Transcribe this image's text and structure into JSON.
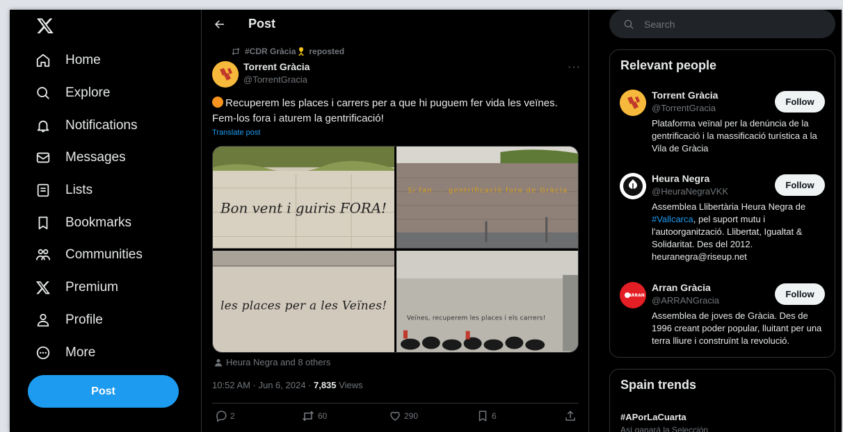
{
  "nav": {
    "items": [
      {
        "label": "Home",
        "icon": "home-icon"
      },
      {
        "label": "Explore",
        "icon": "search-icon"
      },
      {
        "label": "Notifications",
        "icon": "bell-icon"
      },
      {
        "label": "Messages",
        "icon": "envelope-icon"
      },
      {
        "label": "Lists",
        "icon": "list-icon"
      },
      {
        "label": "Bookmarks",
        "icon": "bookmark-icon"
      },
      {
        "label": "Communities",
        "icon": "people-icon"
      },
      {
        "label": "Premium",
        "icon": "x-logo-icon"
      },
      {
        "label": "Profile",
        "icon": "person-icon"
      },
      {
        "label": "More",
        "icon": "more-circle-icon"
      }
    ],
    "post_label": "Post"
  },
  "main": {
    "title": "Post",
    "repost": {
      "reposter": "#CDR Gràcia",
      "suffix": "reposted"
    },
    "tweet": {
      "author_name": "Torrent Gràcia",
      "author_handle": "@TorrentGracia",
      "text": "Recuperem les places i carrers per a que hi puguem fer vida les veïnes. Fem-los fora i aturem la gentrificació!",
      "translate_label": "Translate post",
      "liked_by": "Heura Negra and 8 others",
      "time": "10:52 AM · Jun 6, 2024 · ",
      "views_count": "7,835",
      "views_label": " Views",
      "images": [
        {
          "caption": "Bon vent i guiris FORA!"
        },
        {
          "caption": "Si fan ... gentrificació fora de Gràcia"
        },
        {
          "caption": "les places per a les Veïnes!"
        },
        {
          "caption": "Veïnes, recuperem les places i els carrers!"
        }
      ],
      "actions": {
        "replies": "2",
        "reposts": "60",
        "likes": "290",
        "bookmarks": "6"
      }
    }
  },
  "right": {
    "search_placeholder": "Search",
    "relevant_title": "Relevant people",
    "people": [
      {
        "name": "Torrent Gràcia",
        "handle": "@TorrentGracia",
        "bio": "Plataforma veïnal per la denúncia de la gentrificació i la massificació turística a la Vila de Gràcia",
        "follow_label": "Follow"
      },
      {
        "name": "Heura Negra",
        "handle": "@HeuraNegraVKK",
        "bio_pre": "Assemblea Llibertària Heura Negra de ",
        "bio_link": "#Vallcarca",
        "bio_post": ", pel suport mutu i l'autoorganització. Llibertat, Igualtat & Solidaritat. Des del 2012. heuranegra@riseup.net",
        "follow_label": "Follow"
      },
      {
        "name": "Arran Gràcia",
        "handle": "@ARRANGracia",
        "avatar_text": "ARRAN",
        "bio": "Assemblea de joves de Gràcia. Des de 1996 creant poder popular, lluitant per una terra lliure i construïnt la revolució.",
        "follow_label": "Follow"
      }
    ],
    "trends_title": "Spain trends",
    "trend": {
      "name": "#APorLaCuarta",
      "sub": "Así ganará la Selección"
    }
  },
  "colors": {
    "accent": "#1d9bf0",
    "background": "#000000",
    "text": "#e7e9ea",
    "muted": "#71767b",
    "border": "#2f3336"
  }
}
